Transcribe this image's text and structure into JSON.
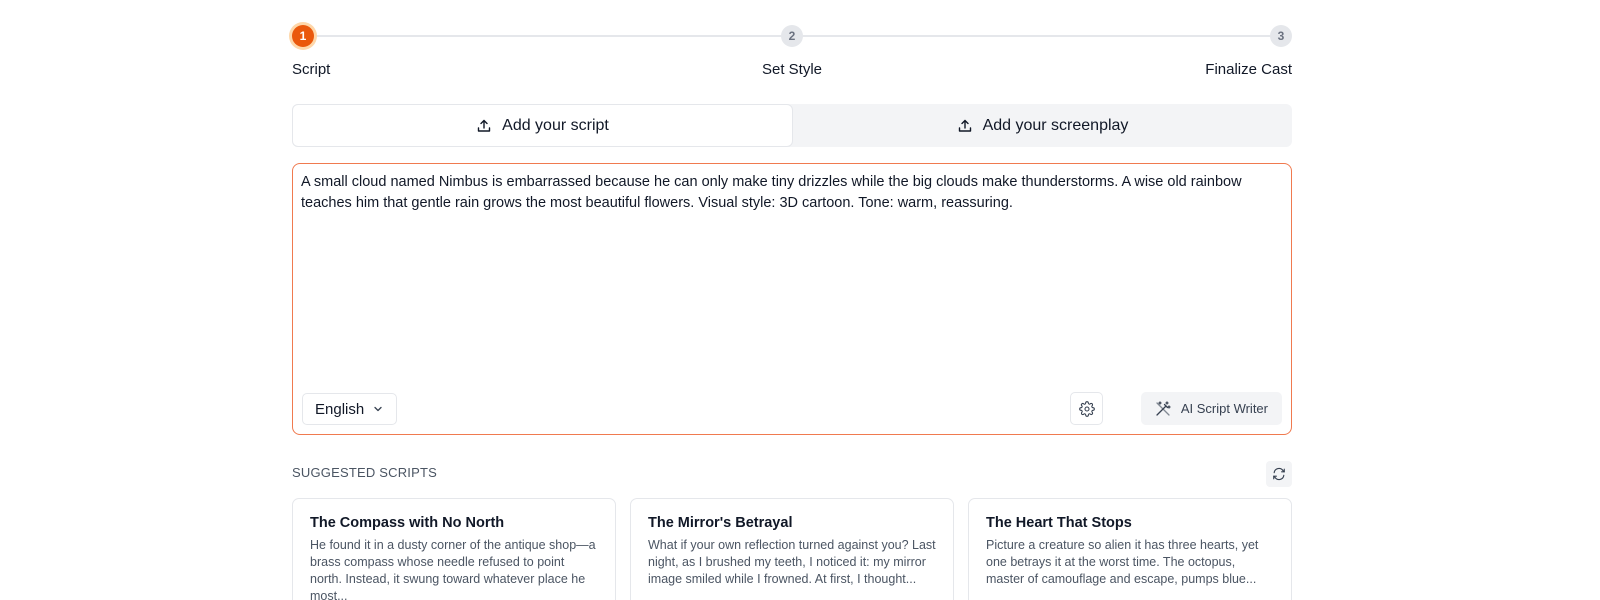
{
  "stepper": {
    "steps": [
      {
        "number": "1",
        "label": "Script"
      },
      {
        "number": "2",
        "label": "Set Style"
      },
      {
        "number": "3",
        "label": "Finalize Cast"
      }
    ],
    "active_step": 1
  },
  "tabs": [
    {
      "label": "Add your script",
      "icon": "upload-icon"
    },
    {
      "label": "Add your screenplay",
      "icon": "upload-icon"
    }
  ],
  "editor": {
    "text": "A small cloud named Nimbus is embarrassed because he can only make tiny drizzles while the big clouds make thunderstorms. A wise old rainbow teaches him that gentle rain grows the most beautiful flowers. Visual style: 3D cartoon. Tone: warm, reassuring.",
    "language": "English",
    "ai_button_label": "AI Script Writer"
  },
  "suggestions": {
    "heading": "SUGGESTED SCRIPTS",
    "cards": [
      {
        "title": "The Compass with No North",
        "excerpt": "He found it in a dusty corner of the antique shop—a brass compass whose needle refused to point north. Instead, it swung toward whatever place he most..."
      },
      {
        "title": "The Mirror's Betrayal",
        "excerpt": "What if your own reflection turned against you? Last night, as I brushed my teeth, I noticed it: my mirror image smiled while I frowned. At first, I thought..."
      },
      {
        "title": "The Heart That Stops",
        "excerpt": "Picture a creature so alien it has three hearts, yet one betrays it at the worst time. The octopus, master of camouflage and escape, pumps blue..."
      }
    ]
  },
  "colors": {
    "accent": "#ea580c",
    "editor_border": "#f07a4f"
  }
}
